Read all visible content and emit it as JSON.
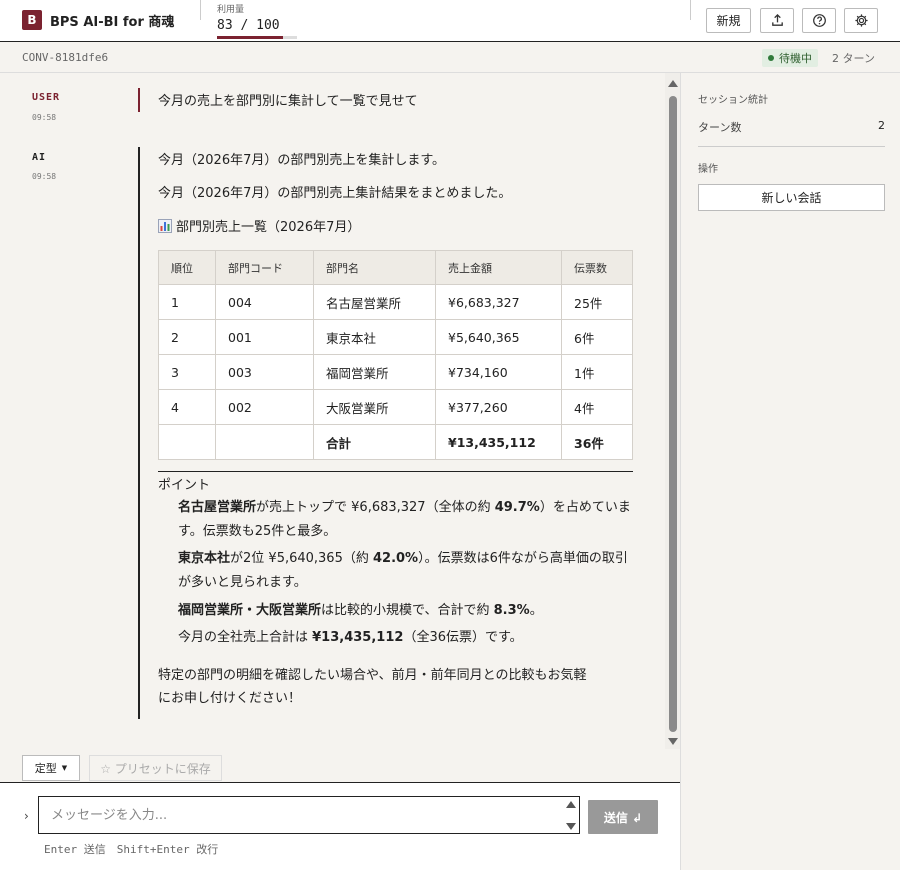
{
  "header": {
    "logo_letter": "B",
    "title": "BPS AI-BI for 商魂",
    "usage_label": "利用量",
    "usage_value": "83 / 100",
    "usage_fraction": 0.83,
    "new_label": "新規"
  },
  "subheader": {
    "conversation_id": "CONV-8181dfe6",
    "status": "待機中",
    "turns": "2 ターン"
  },
  "messages": {
    "user": {
      "role": "USER",
      "time": "09:58",
      "text": "今月の売上を部門別に集計して一覧で見せて"
    },
    "ai": {
      "role": "AI",
      "time": "09:58",
      "line1": "今月（2026年7月）の部門別売上を集計します。",
      "line2": "今月（2026年7月）の部門別売上集計結果をまとめました。",
      "table_title": "部門別売上一覧（2026年7月）",
      "table": {
        "headers": [
          "順位",
          "部門コード",
          "部門名",
          "売上金額",
          "伝票数"
        ],
        "rows": [
          [
            "1",
            "004",
            "名古屋営業所",
            "¥6,683,327",
            "25件"
          ],
          [
            "2",
            "001",
            "東京本社",
            "¥5,640,365",
            "6件"
          ],
          [
            "3",
            "003",
            "福岡営業所",
            "¥734,160",
            "1件"
          ],
          [
            "4",
            "002",
            "大阪営業所",
            "¥377,260",
            "4件"
          ]
        ],
        "total": [
          "",
          "",
          "合計",
          "¥13,435,112",
          "36件"
        ]
      },
      "points_heading": "ポイント",
      "p1_b1": "名古屋営業所",
      "p1_t1": "が売上トップで ¥6,683,327（全体の約 ",
      "p1_b2": "49.7%",
      "p1_t2": "）を占めています。伝票数も25件と最多。",
      "p2_b1": "東京本社",
      "p2_t1": "が2位 ¥5,640,365（約 ",
      "p2_b2": "42.0%",
      "p2_t2": "）。伝票数は6件ながら高単価の取引が多いと見られます。",
      "p3_b1": "福岡営業所・大阪営業所",
      "p3_t1": "は比較的小規模で、合計で約 ",
      "p3_b2": "8.3%",
      "p3_t2": "。",
      "p4_t1": "今月の全社売上合計は ",
      "p4_b1": "¥13,435,112",
      "p4_t2": "（全36伝票）です。",
      "closing1": "特定の部門の明細を確認したい場合や、前月・前年同月との比較もお気軽",
      "closing2": "にお申し付けください！"
    }
  },
  "sidebar": {
    "stats_label": "セッション統計",
    "turns_label": "ターン数",
    "turns_value": "2",
    "ops_label": "操作",
    "new_conversation": "新しい会話"
  },
  "composer": {
    "preset_type": "定型",
    "save_preset": "☆ プリセットに保存",
    "placeholder": "メッセージを入力...",
    "send_label": "送信 ↲",
    "hint": "Enter 送信　Shift+Enter 改行"
  },
  "colors": {
    "brand": "#7b2230",
    "status_green": "#2f7a3a"
  }
}
